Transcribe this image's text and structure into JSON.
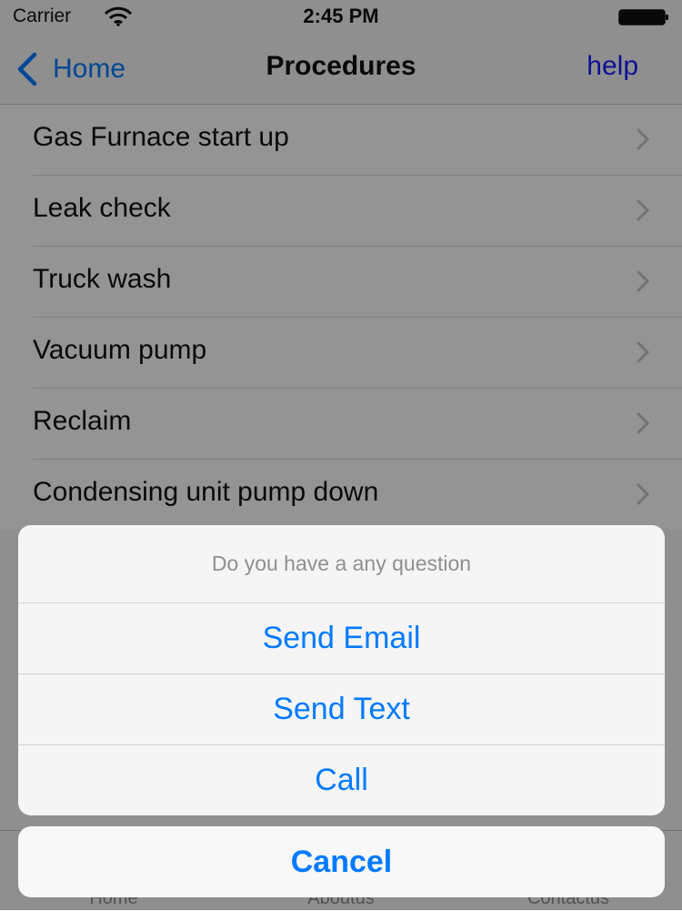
{
  "status_bar": {
    "carrier": "Carrier",
    "time": "2:45 PM",
    "wifi_icon": "wifi-icon",
    "battery_icon": "battery-icon"
  },
  "nav": {
    "back_label": "Home",
    "title": "Procedures",
    "help_label": "help"
  },
  "procedures": [
    "Gas Furnace start up",
    "Leak check",
    "Truck wash",
    "Vacuum pump",
    "Reclaim",
    "Condensing unit pump down"
  ],
  "tab_bar": {
    "tabs": [
      "Home",
      "Aboutus",
      "Contactus"
    ]
  },
  "action_sheet": {
    "title": "Do you have a any question",
    "buttons": [
      "Send Email",
      "Send Text",
      "Call"
    ],
    "cancel_label": "Cancel"
  },
  "colors": {
    "ios_blue": "#007aff",
    "help_blue": "#1a1aff",
    "overlay": "rgba(0,0,0,0.42)"
  }
}
